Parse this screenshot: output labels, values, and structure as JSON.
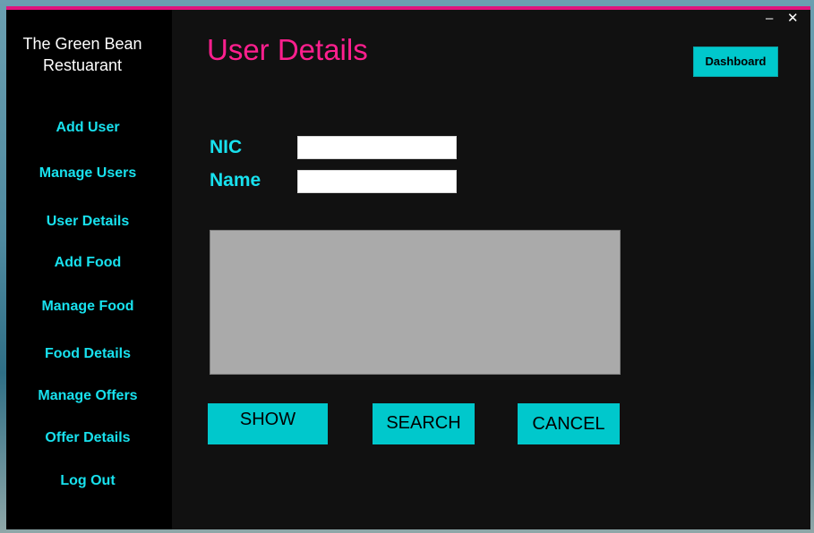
{
  "app": {
    "brand_line1": "The Green Bean",
    "brand_line2": "Restuarant"
  },
  "titlebar": {
    "minimize_glyph": "–",
    "close_glyph": "✕"
  },
  "sidebar": {
    "items": [
      {
        "label": "Add User"
      },
      {
        "label": "Manage Users"
      },
      {
        "label": "User Details"
      },
      {
        "label": "Add Food"
      },
      {
        "label": "Manage Food"
      },
      {
        "label": "Food Details"
      },
      {
        "label": "Manage Offers"
      },
      {
        "label": "Offer Details"
      },
      {
        "label": "Log Out"
      }
    ]
  },
  "main": {
    "title": "User Details",
    "dashboard_label": "Dashboard",
    "nic_label": "NIC",
    "nic_value": "",
    "name_label": "Name",
    "name_value": "",
    "show_label": "SHOW",
    "search_label": "SEARCH",
    "cancel_label": "CANCEL"
  },
  "colors": {
    "accent_pink": "#ff1f8e",
    "accent_cyan": "#18e1ee",
    "button_cyan": "#00c8cc",
    "window_bg": "#111111",
    "sidebar_bg": "#000000",
    "grid_bg": "#aaaaaa"
  }
}
